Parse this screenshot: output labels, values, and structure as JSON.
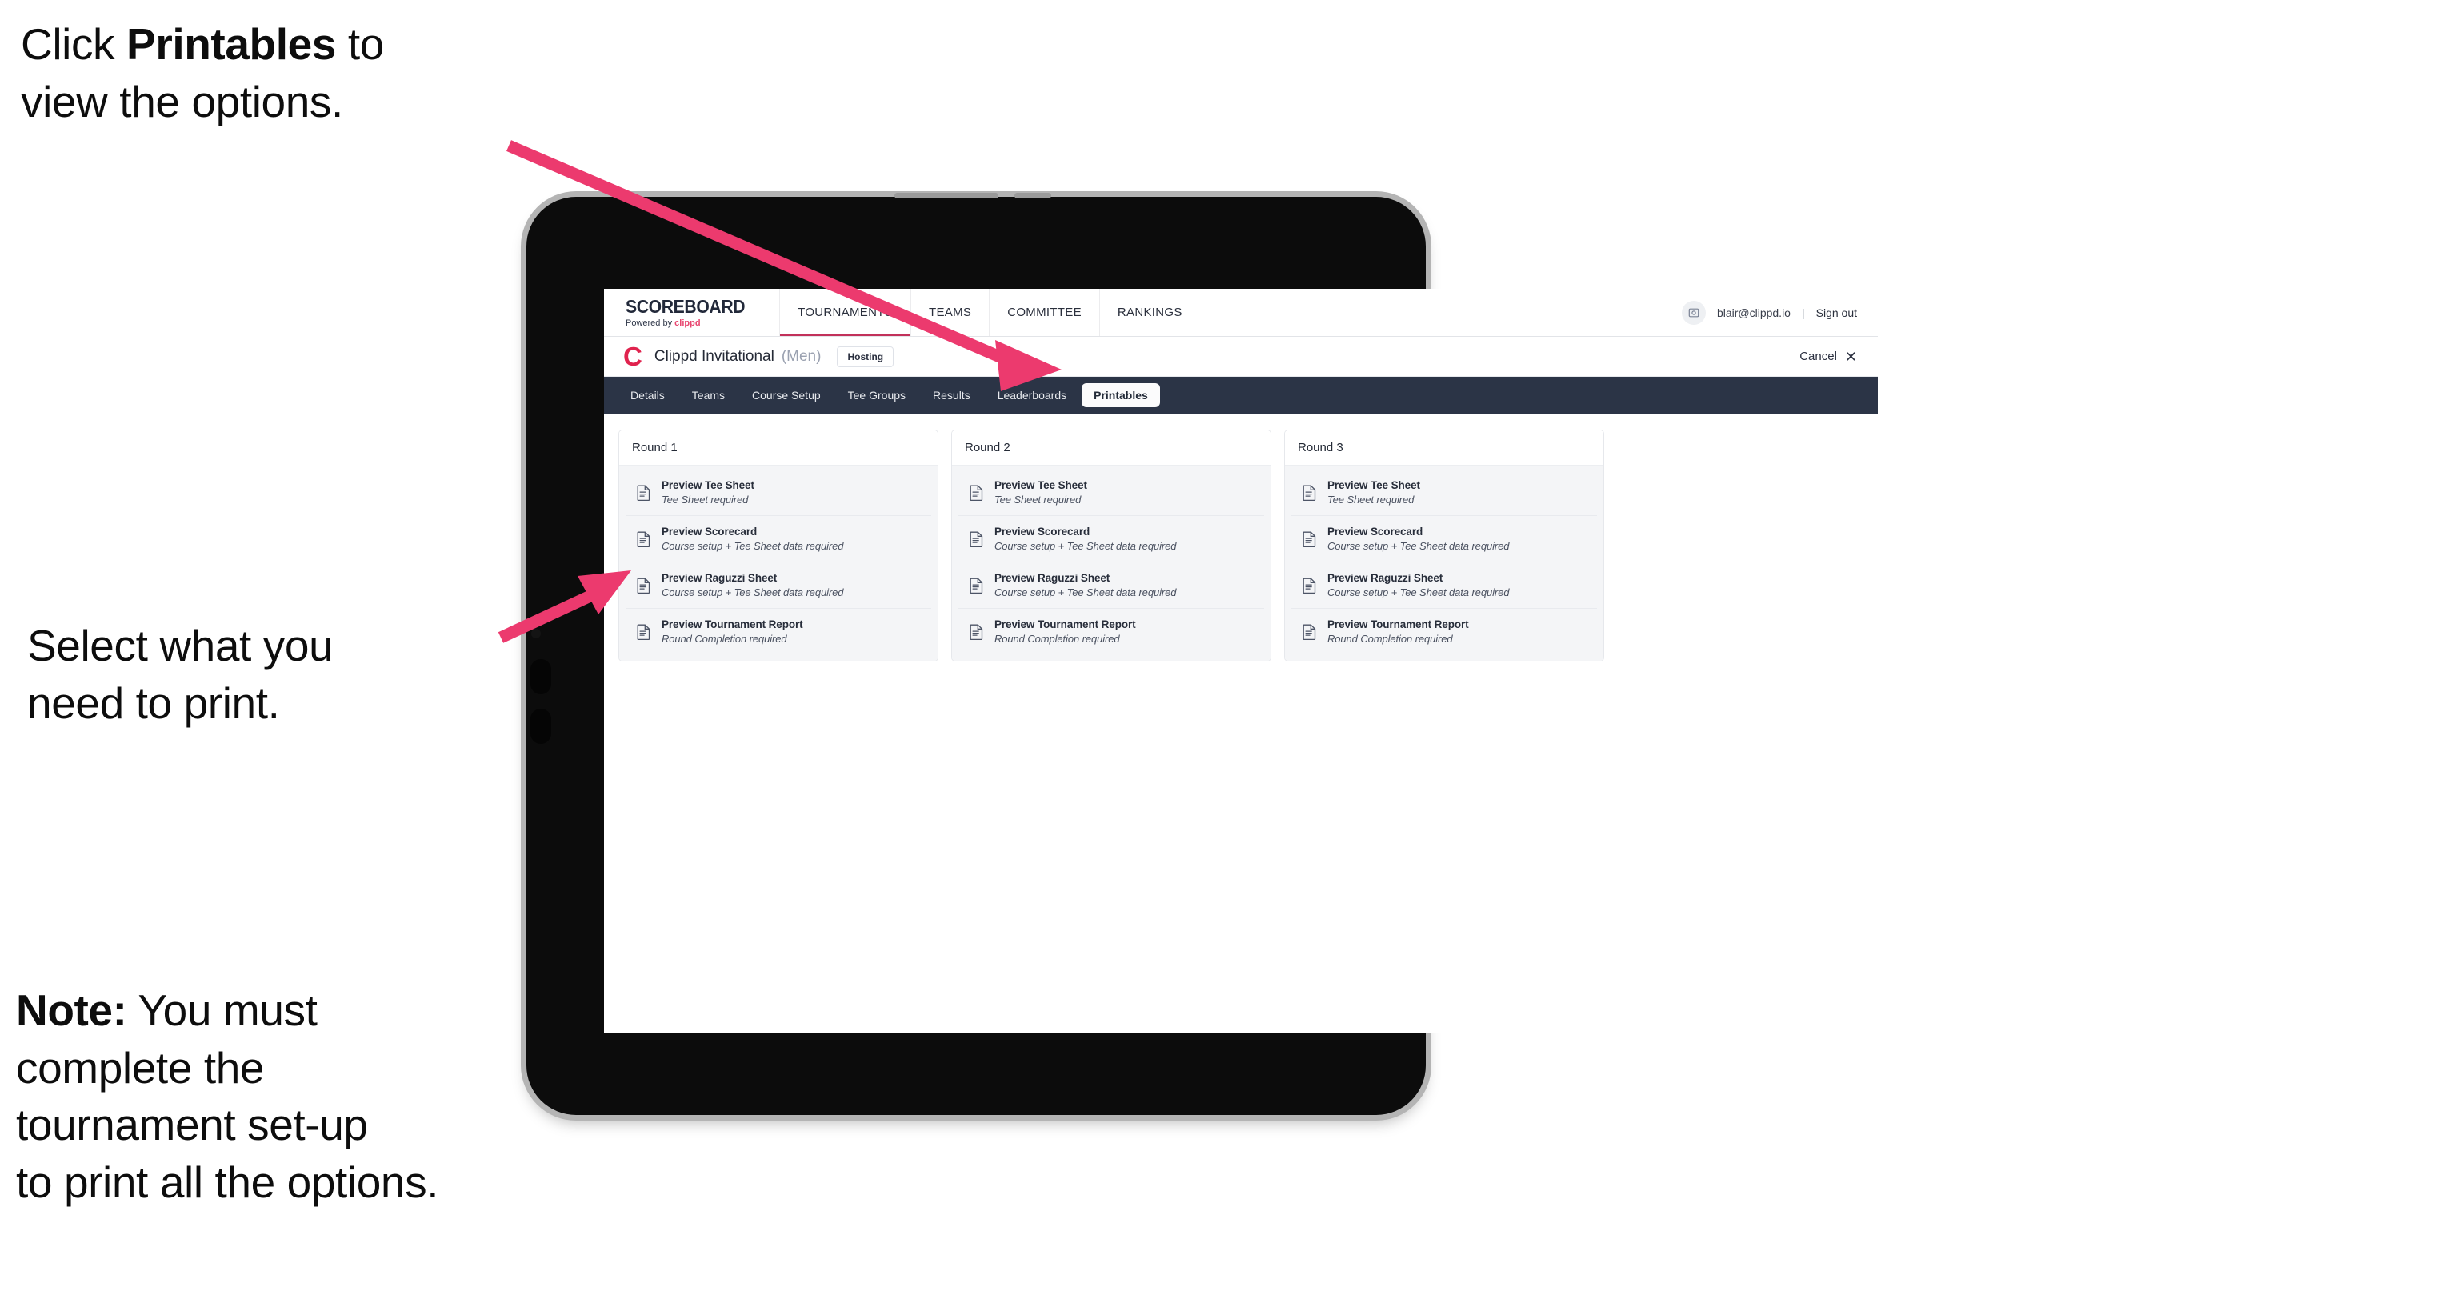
{
  "annotations": {
    "callout_1": {
      "pre": "Click ",
      "bold": "Printables",
      "post": " to\nview the options."
    },
    "callout_2": {
      "text": "Select what you\n need to print."
    },
    "callout_3": {
      "bold": "Note:",
      "post": " You must\ncomplete the\ntournament set-up\nto print all the options."
    }
  },
  "app": {
    "brand": {
      "title": "SCOREBOARD",
      "powered_prefix": "Powered by ",
      "powered_brand": "clippd"
    },
    "topnav": {
      "links": [
        {
          "label": "TOURNAMENTS",
          "active": true
        },
        {
          "label": "TEAMS",
          "active": false
        },
        {
          "label": "COMMITTEE",
          "active": false
        },
        {
          "label": "RANKINGS",
          "active": false
        }
      ],
      "user_email": "blair@clippd.io",
      "separator": "|",
      "sign_out": "Sign out",
      "avatar_icon": "user-avatar-icon"
    },
    "tournament_bar": {
      "logo_letter": "C",
      "name": "Clippd Invitational",
      "gender": "(Men)",
      "badge": "Hosting",
      "cancel_label": "Cancel",
      "cancel_icon": "close-x-icon"
    },
    "tabs": [
      {
        "label": "Details",
        "active": false
      },
      {
        "label": "Teams",
        "active": false
      },
      {
        "label": "Course Setup",
        "active": false
      },
      {
        "label": "Tee Groups",
        "active": false
      },
      {
        "label": "Results",
        "active": false
      },
      {
        "label": "Leaderboards",
        "active": false
      },
      {
        "label": "Printables",
        "active": true
      }
    ],
    "rounds": [
      {
        "title": "Round 1",
        "items": [
          {
            "title": "Preview Tee Sheet",
            "subtitle": "Tee Sheet required"
          },
          {
            "title": "Preview Scorecard",
            "subtitle": "Course setup + Tee Sheet data required"
          },
          {
            "title": "Preview Raguzzi Sheet",
            "subtitle": "Course setup + Tee Sheet data required"
          },
          {
            "title": "Preview Tournament Report",
            "subtitle": "Round Completion required"
          }
        ]
      },
      {
        "title": "Round 2",
        "items": [
          {
            "title": "Preview Tee Sheet",
            "subtitle": "Tee Sheet required"
          },
          {
            "title": "Preview Scorecard",
            "subtitle": "Course setup + Tee Sheet data required"
          },
          {
            "title": "Preview Raguzzi Sheet",
            "subtitle": "Course setup + Tee Sheet data required"
          },
          {
            "title": "Preview Tournament Report",
            "subtitle": "Round Completion required"
          }
        ]
      },
      {
        "title": "Round 3",
        "items": [
          {
            "title": "Preview Tee Sheet",
            "subtitle": "Tee Sheet required"
          },
          {
            "title": "Preview Scorecard",
            "subtitle": "Course setup + Tee Sheet data required"
          },
          {
            "title": "Preview Raguzzi Sheet",
            "subtitle": "Course setup + Tee Sheet data required"
          },
          {
            "title": "Preview Tournament Report",
            "subtitle": "Round Completion required"
          }
        ]
      }
    ]
  },
  "colors": {
    "accent_pink": "#ec3a6e",
    "brand_red": "#e0234e",
    "tabstrip_dark": "#2b3446",
    "active_underline": "#c2315a",
    "card_bg": "#f4f5f7"
  }
}
